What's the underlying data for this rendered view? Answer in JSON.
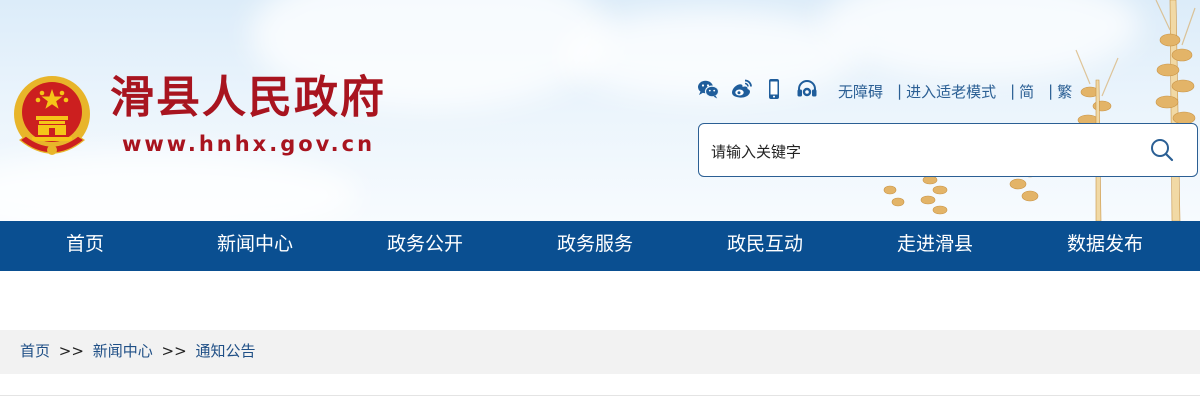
{
  "site": {
    "title": "滑县人民政府",
    "url": "www.hnhx.gov.cn"
  },
  "social_icons": [
    "wechat-icon",
    "weibo-icon",
    "mobile-icon",
    "headset-icon"
  ],
  "top_links": {
    "accessibility": "无障碍",
    "elderly_mode": "进入适老模式",
    "simplified": "简",
    "traditional": "繁",
    "separator": "|"
  },
  "search": {
    "placeholder": "请输入关键字"
  },
  "nav": {
    "items": [
      "首页",
      "新闻中心",
      "政务公开",
      "政务服务",
      "政民互动",
      "走进滑县",
      "数据发布"
    ]
  },
  "breadcrumb": {
    "items": [
      "首页",
      "新闻中心",
      "通知公告"
    ],
    "separator": ">>"
  },
  "colors": {
    "title_red": "#a8141f",
    "nav_blue": "#0a4f91",
    "link_blue": "#2b5f94"
  }
}
